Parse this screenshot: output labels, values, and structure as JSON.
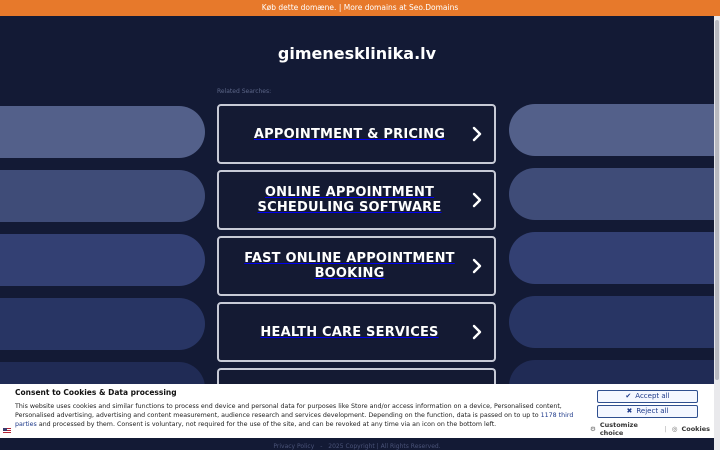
{
  "banner": {
    "buy_text": "Køb dette domæne.",
    "separator": "|",
    "more_text": "More domains at Seo.Domains"
  },
  "page": {
    "domain": "gimenesklinika.lv",
    "related_label": "Related Searches:"
  },
  "links": [
    {
      "label": "APPOINTMENT & PRICING"
    },
    {
      "label": "ONLINE APPOINTMENT SCHEDULING SOFTWARE"
    },
    {
      "label": "FAST ONLINE APPOINTMENT BOOKING"
    },
    {
      "label": "HEALTH CARE SERVICES"
    }
  ],
  "footer": {
    "privacy": "Privacy Policy",
    "copyright": "2025 Copyright | All Rights Reserved."
  },
  "consent": {
    "title": "Consent to Cookies & Data processing",
    "body_part1": "This website uses cookies and similar functions to process end device and personal data for purposes like Store and/or access information on a device, Personalised content, Personalised advertising, advertising and content measurement, audience research and services development. Depending on the function, data is passed on to up to ",
    "body_link": "1178 third parties",
    "body_part2": " and processed by them. Consent is voluntary, not required for the use of the site, and can be revoked at any time via an icon on the bottom left.",
    "accept_label": "Accept all",
    "reject_label": "Reject all",
    "customize_label": "Customize choice",
    "cookies_label": "Cookies",
    "separator": "|"
  },
  "colors": {
    "banner": "#e7792b",
    "background": "#141a33",
    "accent_link": "#1e3a8a"
  }
}
